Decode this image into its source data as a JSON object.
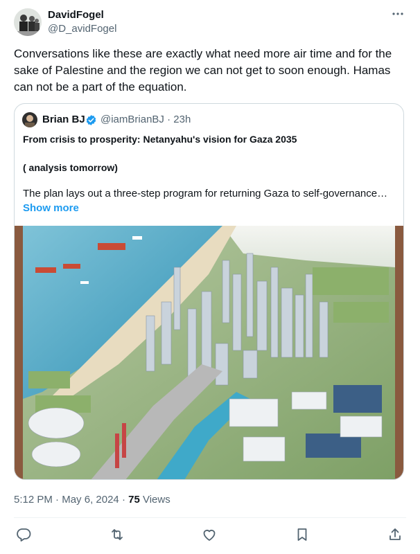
{
  "author": {
    "name": "DavidFogel",
    "handle": "@D_avidFogel"
  },
  "tweet": {
    "text": "Conversations like these are exactly what need more air time and for the sake of Palestine and the region we can not get to soon enough. Hamas can not be a part of the equation.",
    "time": "5:12 PM",
    "separator": "·",
    "date": "May 6, 2024",
    "views_count": "75",
    "views_label": "Views"
  },
  "quote": {
    "name": "Brian BJ",
    "handle": "@iamBrianBJ",
    "time": "23h",
    "separator": "·",
    "title": "From crisis to prosperity: Netanyahu's vision for Gaza 2035",
    "subtitle": "( analysis tomorrow)",
    "text": "The plan lays out a three-step program for returning Gaza to self-governance…",
    "show_more": "Show more"
  },
  "icons": {
    "more": "more-icon",
    "reply": "reply-icon",
    "retweet": "retweet-icon",
    "like": "heart-icon",
    "bookmark": "bookmark-icon",
    "share": "share-icon",
    "verified": "verified-badge-icon"
  },
  "colors": {
    "text": "#0f1419",
    "secondary": "#536471",
    "link": "#1d9bf0",
    "border": "#cfd9de"
  }
}
